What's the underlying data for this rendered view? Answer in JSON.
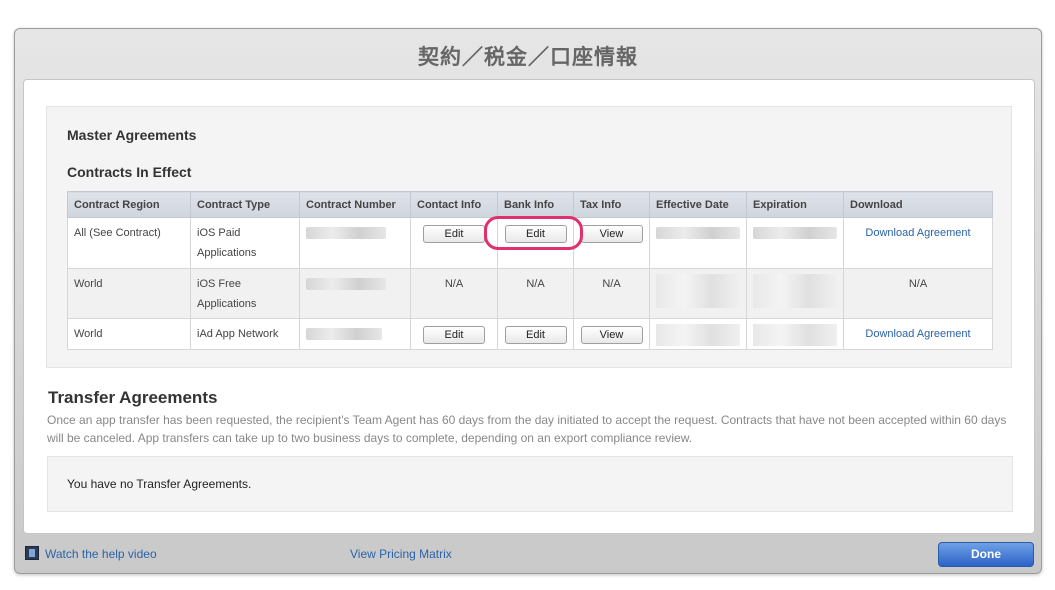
{
  "window": {
    "title": "契約／税金／口座情報"
  },
  "master": {
    "heading": "Master Agreements",
    "subheading": "Contracts In Effect"
  },
  "table": {
    "headers": [
      "Contract Region",
      "Contract Type",
      "Contract Number",
      "Contact Info",
      "Bank Info",
      "Tax Info",
      "Effective Date",
      "Expiration",
      "Download"
    ],
    "rows": [
      {
        "region": "All (See Contract)",
        "type_line1": "iOS Paid",
        "type_line2": "Applications",
        "contact": "Edit",
        "bank": "Edit",
        "tax": "View",
        "download": "Download Agreement"
      },
      {
        "region": "World",
        "type_line1": "iOS Free",
        "type_line2": "Applications",
        "contact": "N/A",
        "bank": "N/A",
        "tax": "N/A",
        "download": "N/A"
      },
      {
        "region": "World",
        "type_line1": "iAd App Network",
        "type_line2": "",
        "contact": "Edit",
        "bank": "Edit",
        "tax": "View",
        "download": "Download Agreement"
      }
    ]
  },
  "transfer": {
    "heading": "Transfer Agreements",
    "description": "Once an app transfer has been requested, the recipient's Team Agent has 60 days from the day initiated to accept the request. Contracts that have not been accepted within 60 days will be canceled. App transfers can take up to two business days to complete, depending on an export compliance review.",
    "empty": "You have no Transfer Agreements."
  },
  "footer": {
    "help_video": "Watch the help video",
    "pricing": "View Pricing Matrix",
    "done": "Done"
  },
  "colors": {
    "link": "#2a63a8",
    "highlight": "#e0306f",
    "done": "#2c63c8"
  }
}
